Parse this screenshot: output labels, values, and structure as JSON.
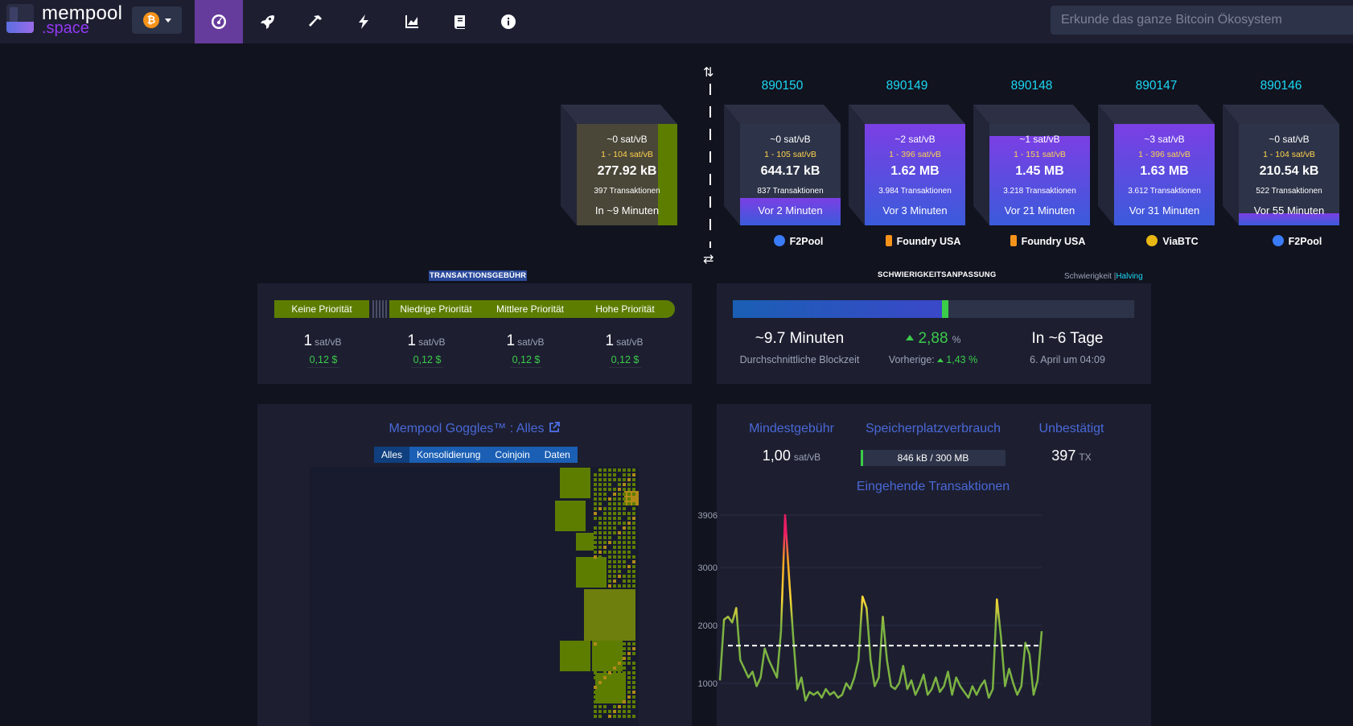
{
  "brand": {
    "line1": "mempool",
    "line2": ".space"
  },
  "network": {
    "symbol": "₿"
  },
  "nav": [
    {
      "icon": "dashboard-icon",
      "active": true
    },
    {
      "icon": "rocket-icon",
      "active": false
    },
    {
      "icon": "hammer-icon",
      "active": false
    },
    {
      "icon": "lightning-icon",
      "active": false
    },
    {
      "icon": "graphs-icon",
      "active": false
    },
    {
      "icon": "docs-icon",
      "active": false
    },
    {
      "icon": "info-icon",
      "active": false
    }
  ],
  "search": {
    "placeholder": "Erkunde das ganze Bitcoin Ökosystem"
  },
  "mempool_block": {
    "median": "~0 sat/vB",
    "range": "1 - 104 sat/vB",
    "size": "277.92 kB",
    "tx": "397 Transaktionen",
    "eta": "In ~9 Minuten",
    "fill": 0.19
  },
  "blocks": [
    {
      "height": "890150",
      "median": "~0 sat/vB",
      "range": "1 - 105 sat/vB",
      "size": "644.17 kB",
      "tx": "837 Transaktionen",
      "age": "Vor 2 Minuten",
      "pool": "F2Pool",
      "fill": 0.27,
      "pool_color": "#3a7bf7"
    },
    {
      "height": "890149",
      "median": "~2 sat/vB",
      "range": "1 - 396 sat/vB",
      "size": "1.62 MB",
      "tx": "3.984 Transaktionen",
      "age": "Vor 3 Minuten",
      "pool": "Foundry USA",
      "fill": 1.0,
      "pool_color": "#f7931a"
    },
    {
      "height": "890148",
      "median": "~1 sat/vB",
      "range": "1 - 151 sat/vB",
      "size": "1.45 MB",
      "tx": "3.218 Transaktionen",
      "age": "Vor 21 Minuten",
      "pool": "Foundry USA",
      "fill": 0.88,
      "pool_color": "#f7931a"
    },
    {
      "height": "890147",
      "median": "~3 sat/vB",
      "range": "1 - 396 sat/vB",
      "size": "1.63 MB",
      "tx": "3.612 Transaktionen",
      "age": "Vor 31 Minuten",
      "pool": "ViaBTC",
      "fill": 1.0,
      "pool_color": "#e8b713"
    },
    {
      "height": "890146",
      "median": "~0 sat/vB",
      "range": "1 - 104 sat/vB",
      "size": "210.54 kB",
      "tx": "522 Transaktionen",
      "age": "Vor 55 Minuten",
      "pool": "F2Pool",
      "fill": 0.12,
      "pool_color": "#3a7bf7"
    }
  ],
  "fees": {
    "section_title": "TRANSAKTIONSGEBÜHR",
    "labels": [
      "Keine Priorität",
      "Niedrige Priorität",
      "Mittlere Priorität",
      "Hohe Priorität"
    ],
    "values": [
      "1",
      "1",
      "1",
      "1"
    ],
    "unit": "sat/vB",
    "usd": [
      "0,12 $",
      "0,12 $",
      "0,12 $",
      "0,12 $"
    ]
  },
  "difficulty": {
    "section_title": "SCHWIERIGKEITSANPASSUNG",
    "link_difficulty": "Schwierigkeit",
    "link_sep": "|",
    "link_halving": "Halving",
    "progress": 0.53,
    "block_time": "~9.7 Minuten",
    "block_time_label": "Durchschnittliche Blockzeit",
    "change": "2,88",
    "change_unit": "%",
    "previous_label": "Vorherige:",
    "previous": "1,43 %",
    "eta": "In ~6 Tage",
    "eta_date": "6. April um 04:09"
  },
  "goggles": {
    "title": "Mempool Goggles™ : Alles",
    "tabs": [
      "Alles",
      "Konsolidierung",
      "Coinjoin",
      "Daten"
    ]
  },
  "mempool_stats": {
    "min_fee_title": "Mindestgebühr",
    "min_fee": "1,00",
    "min_fee_unit": "sat/vB",
    "memory_title": "Speicherplatzverbrauch",
    "memory": "846 kB / 300 MB",
    "memory_fill": 0.003,
    "unconfirmed_title": "Unbestätigt",
    "unconfirmed": "397",
    "unconfirmed_unit": "TX",
    "chart_title": "Eingehende Transaktionen"
  },
  "chart_data": {
    "type": "line",
    "title": "Eingehende Transaktionen",
    "y_ticks": [
      "3906",
      "3000",
      "2000",
      "1000"
    ],
    "ylim": [
      680,
      3906
    ],
    "reference_line": 1650,
    "colors": {
      "low": "#7cb342",
      "mid": "#fdd835",
      "high": "#e91e63"
    },
    "values": [
      1050,
      2100,
      2150,
      2050,
      2300,
      1400,
      1250,
      1100,
      1200,
      950,
      1100,
      1600,
      1400,
      1250,
      1100,
      1900,
      3906,
      2800,
      1800,
      900,
      1100,
      700,
      850,
      800,
      850,
      750,
      900,
      800,
      850,
      750,
      800,
      1000,
      900,
      1100,
      1400,
      2500,
      2300,
      1400,
      950,
      1100,
      2150,
      1400,
      950,
      900,
      1000,
      1300,
      900,
      1050,
      800,
      950,
      1150,
      800,
      900,
      1100,
      850,
      950,
      1200,
      800,
      1100,
      950,
      850,
      750,
      950,
      800,
      950,
      1050,
      750,
      900,
      2450,
      1800,
      950,
      1250,
      1000,
      800,
      950,
      1700,
      1500,
      800,
      1050,
      1900
    ]
  }
}
